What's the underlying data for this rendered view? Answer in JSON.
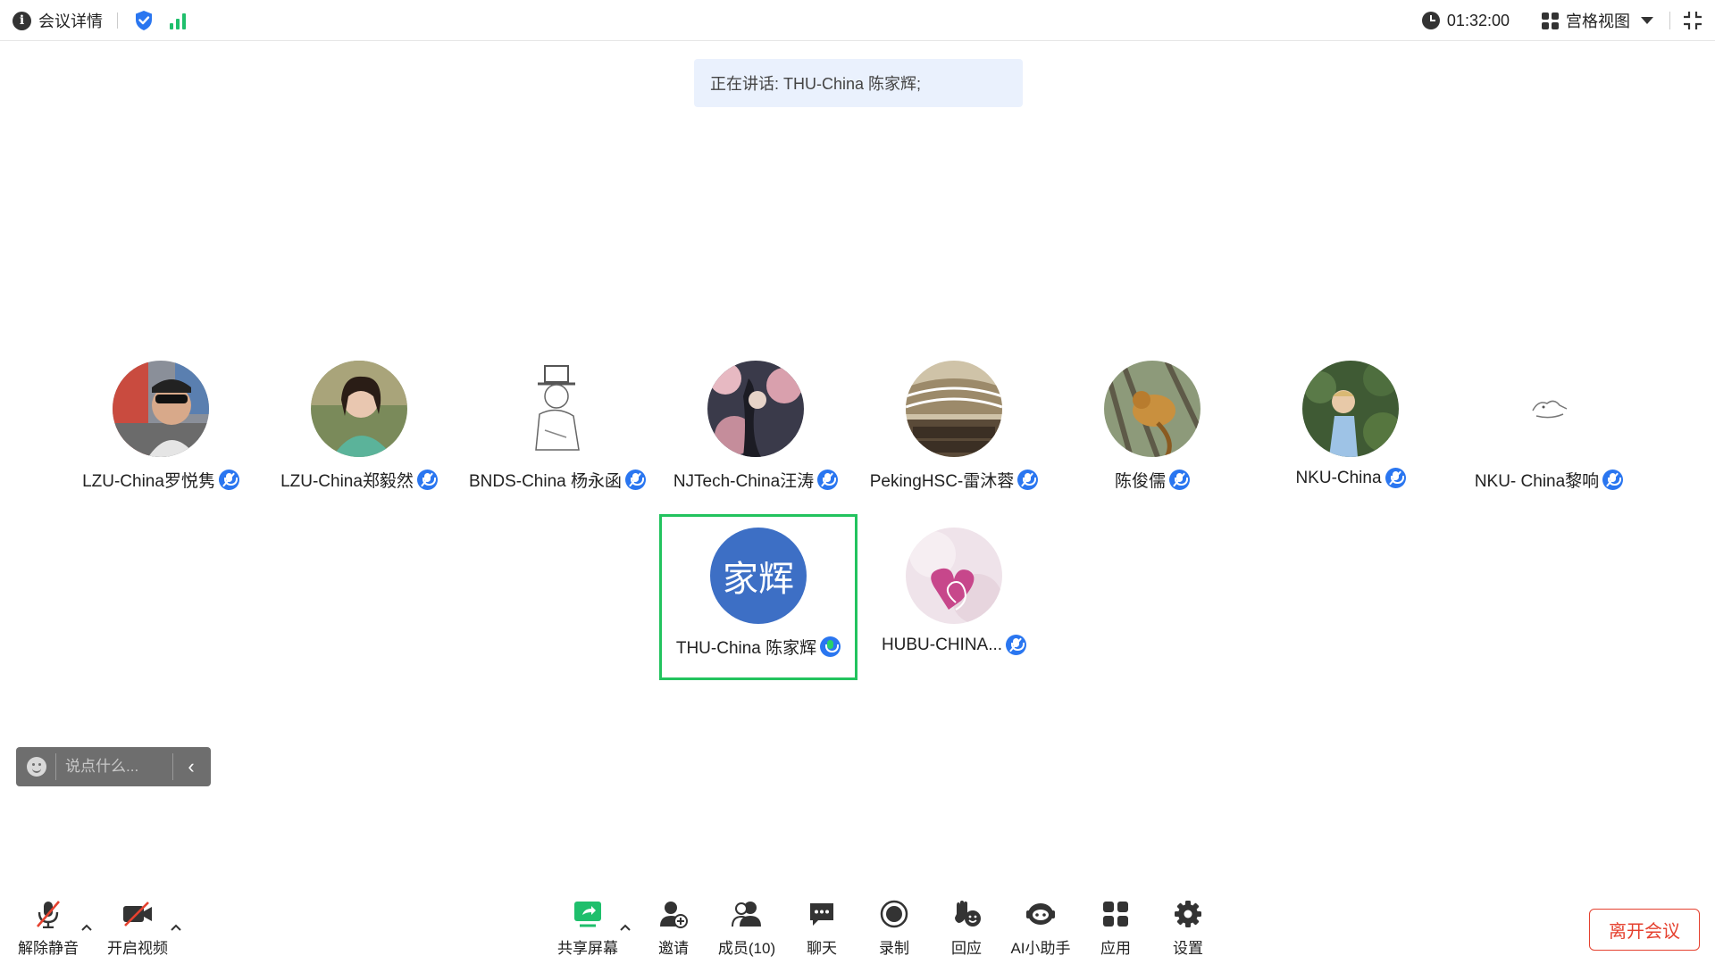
{
  "topbar": {
    "meeting_details_label": "会议详情",
    "time": "01:32:00",
    "view_label": "宫格视图"
  },
  "speaking": {
    "text": "正在讲话: THU-China 陈家辉;"
  },
  "participants": [
    {
      "name": "LZU-China罗悦隽",
      "mic": "unmuted"
    },
    {
      "name": "LZU-China郑毅然",
      "mic": "unmuted"
    },
    {
      "name": "BNDS-China 杨永函",
      "mic": "unmuted"
    },
    {
      "name": "NJTech-China汪涛",
      "mic": "unmuted"
    },
    {
      "name": "PekingHSC-雷沐蓉",
      "mic": "unmuted"
    },
    {
      "name": "陈俊儒",
      "mic": "unmuted"
    },
    {
      "name": "NKU-China",
      "mic": "unmuted"
    },
    {
      "name": "NKU- China黎响",
      "mic": "unmuted"
    },
    {
      "name": "THU-China 陈家辉",
      "mic": "speaking",
      "avatar_text": "家辉",
      "active": true
    },
    {
      "name": "HUBU-CHINA...",
      "mic": "unmuted"
    }
  ],
  "chat": {
    "placeholder": "说点什么..."
  },
  "toolbar": {
    "unmute": "解除静音",
    "start_video": "开启视频",
    "share_screen": "共享屏幕",
    "invite": "邀请",
    "members": "成员(10)",
    "chat": "聊天",
    "record": "录制",
    "reactions": "回应",
    "ai_assistant": "AI小助手",
    "apps": "应用",
    "settings": "设置",
    "leave": "离开会议"
  },
  "colors": {
    "accent_blue": "#2a76f0",
    "speaking_border": "#22c35e",
    "leave_red": "#e5412f",
    "avatar_blue": "#3d6fc5"
  }
}
